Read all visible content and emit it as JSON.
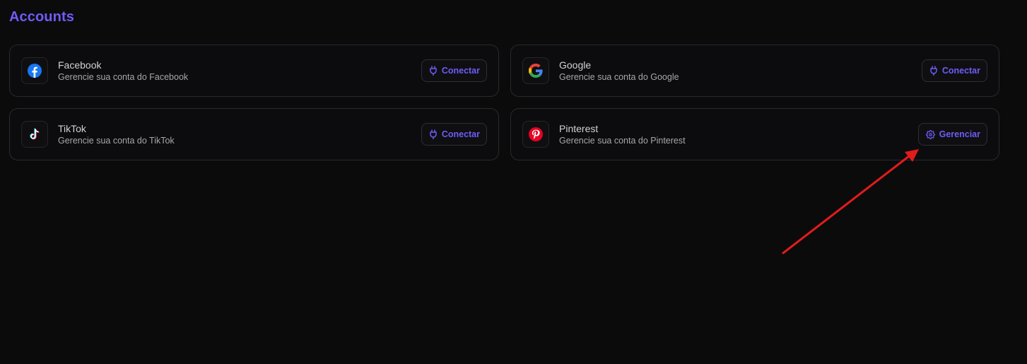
{
  "page": {
    "title": "Accounts"
  },
  "colors": {
    "accent": "#6d5cf6",
    "background": "#0b0b0c",
    "annotation_arrow": "#e21b1b"
  },
  "accounts": [
    {
      "name": "Facebook",
      "description": "Gerencie sua conta do Facebook",
      "icon": "facebook-icon",
      "button": {
        "label": "Conectar",
        "icon": "plug-icon"
      }
    },
    {
      "name": "Google",
      "description": "Gerencie sua conta do Google",
      "icon": "google-icon",
      "button": {
        "label": "Conectar",
        "icon": "plug-icon"
      }
    },
    {
      "name": "TikTok",
      "description": "Gerencie sua conta do TikTok",
      "icon": "tiktok-icon",
      "button": {
        "label": "Conectar",
        "icon": "plug-icon"
      }
    },
    {
      "name": "Pinterest",
      "description": "Gerencie sua conta do Pinterest",
      "icon": "pinterest-icon",
      "button": {
        "label": "Gerenciar",
        "icon": "gear-icon"
      }
    }
  ]
}
